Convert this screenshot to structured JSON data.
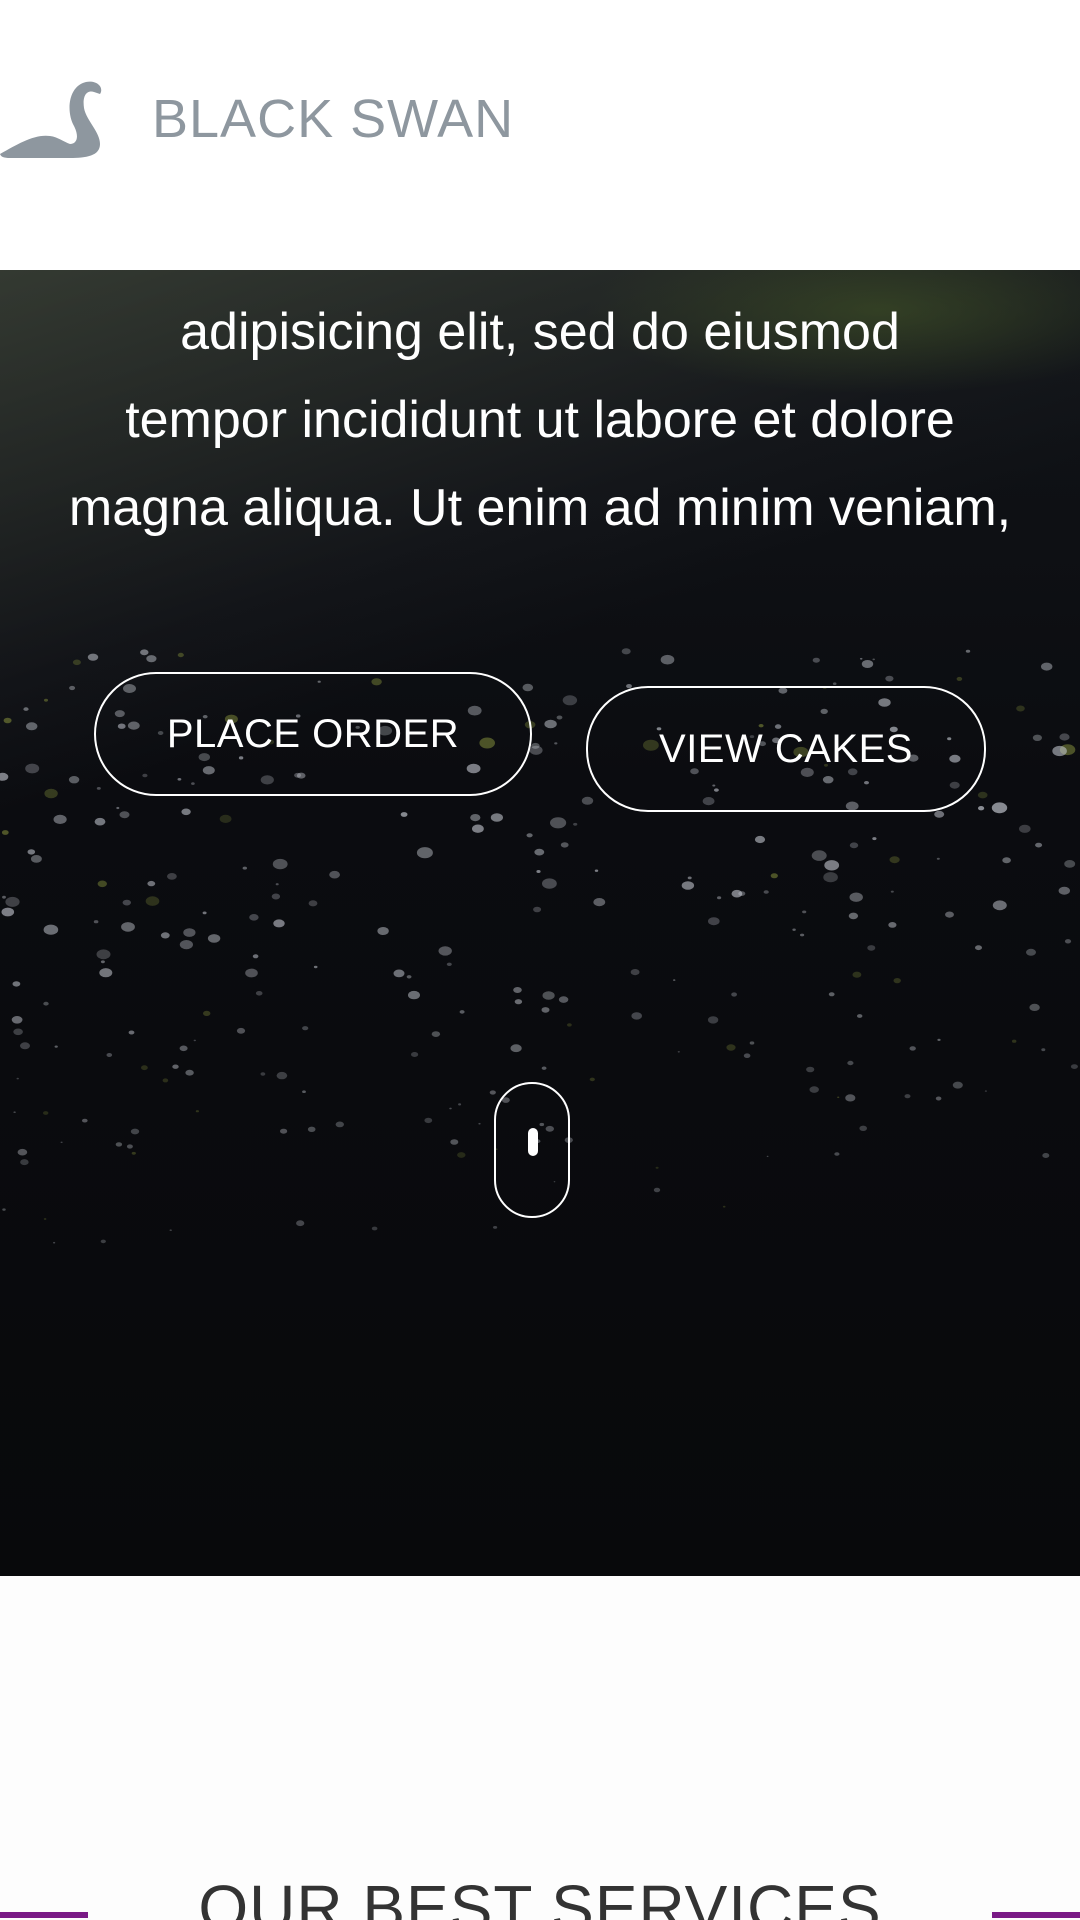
{
  "brand": {
    "name": "BLACK SWAN",
    "logo_icon": "swan-icon"
  },
  "hero": {
    "lines": [
      "adipisicing elit, sed do eiusmod",
      "tempor incididunt ut labore et dolore",
      "magna aliqua. Ut enim ad minim veniam,"
    ],
    "place_order_label": "PLACE ORDER",
    "view_cakes_label": "VIEW CAKES",
    "scroll_icon": "mouse-scroll-icon"
  },
  "services": {
    "title": "OUR BEST SERVICES",
    "accent_color": "#7a1a86"
  },
  "colors": {
    "logo_gray": "#8e979f",
    "hero_bg": "#0b0c10",
    "text_on_dark": "#ffffff"
  }
}
